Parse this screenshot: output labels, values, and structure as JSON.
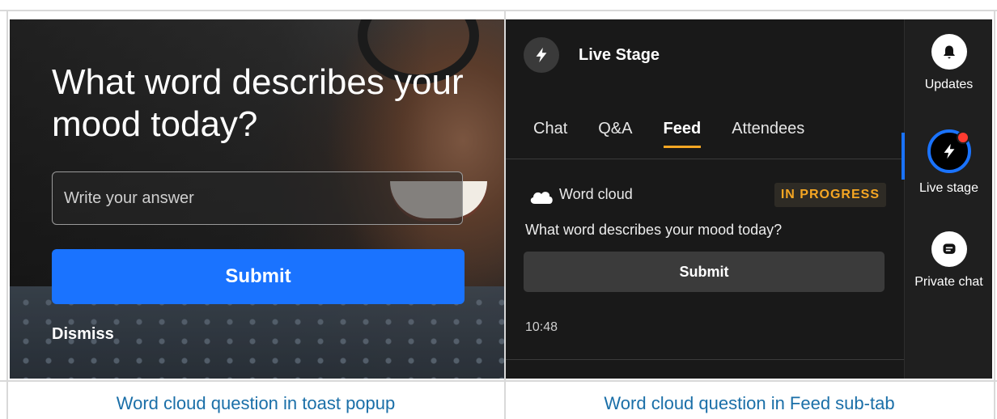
{
  "left_panel": {
    "question": "What word describes your mood today?",
    "input_placeholder": "Write your answer",
    "submit_label": "Submit",
    "dismiss_label": "Dismiss",
    "caption": "Word cloud question in toast popup"
  },
  "right_panel": {
    "stage_title": "Live Stage",
    "tabs": [
      {
        "label": "Chat",
        "active": false
      },
      {
        "label": "Q&A",
        "active": false
      },
      {
        "label": "Feed",
        "active": true
      },
      {
        "label": "Attendees",
        "active": false
      }
    ],
    "card": {
      "type_label": "Word cloud",
      "status_badge": "IN PROGRESS",
      "question": "What word describes your mood today?",
      "submit_label": "Submit",
      "time": "10:48"
    },
    "rail": {
      "updates_label": "Updates",
      "live_stage_label": "Live stage",
      "private_chat_label": "Private chat"
    },
    "caption": "Word cloud question in Feed sub-tab"
  },
  "colors": {
    "accent_blue": "#1a73ff",
    "tab_underline": "#f5a623",
    "badge_text": "#f5a623",
    "caption_text": "#1a6fa8",
    "notification_dot": "#ff3b30"
  }
}
